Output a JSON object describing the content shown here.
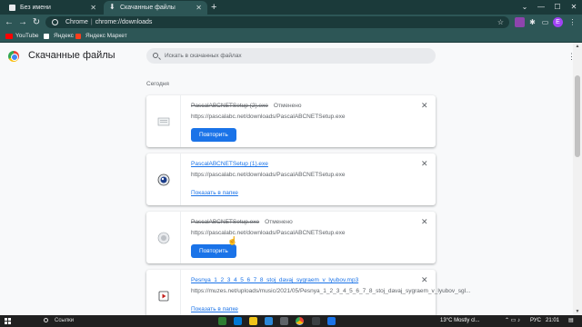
{
  "browser": {
    "tabs": [
      {
        "label": "Без имени"
      },
      {
        "label": "Скачанные файлы"
      }
    ],
    "omnibox": {
      "scheme": "Chrome",
      "path": "chrome://downloads"
    },
    "profile_initial": "E",
    "bookmarks": [
      {
        "label": "YouTube",
        "color": "#ff0000"
      },
      {
        "label": "Яндекс",
        "color": "#ffffff"
      },
      {
        "label": "Яндекс Маркет",
        "color": "#fc3f1d"
      }
    ]
  },
  "page": {
    "title": "Скачанные файлы",
    "search_placeholder": "Искать в скачанных файлах",
    "section_label": "Сегодня",
    "retry_label": "Повторить",
    "show_in_folder_label": "Показать в папке",
    "downloads": [
      {
        "name": "PascalABCNETSetup (2).exe",
        "status": "Отменено",
        "url": "https://pascalabc.net/downloads/PascalABCNETSetup.exe",
        "state": "cancelled",
        "icon": "file-generic-icon"
      },
      {
        "name": "PascalABCNETSetup (1).exe",
        "status": "",
        "url": "https://pascalabc.net/downloads/PascalABCNETSetup.exe",
        "state": "complete",
        "icon": "pascal-installer-icon"
      },
      {
        "name": "PascalABCNETSetup.exe",
        "status": "Отменено",
        "url": "https://pascalabc.net/downloads/PascalABCNETSetup.exe",
        "state": "cancelled",
        "icon": "file-generic-icon"
      },
      {
        "name": "Pesnya_1_2_3_4_5_6_7_8_stoj_davaj_sygraem_v_lyubov.mp3",
        "status": "",
        "url": "https://muzes.net/uploads/music/2021/05/Pesnya_1_2_3_4_5_6_7_8_stoj_davaj_sygraem_v_lyubov_sgl...",
        "state": "complete",
        "icon": "audio-file-icon"
      }
    ]
  },
  "taskbar": {
    "search_label": "Ссылки",
    "weather": "13°C  Mostly cl...",
    "lang": "РУС",
    "time": "21:01"
  }
}
